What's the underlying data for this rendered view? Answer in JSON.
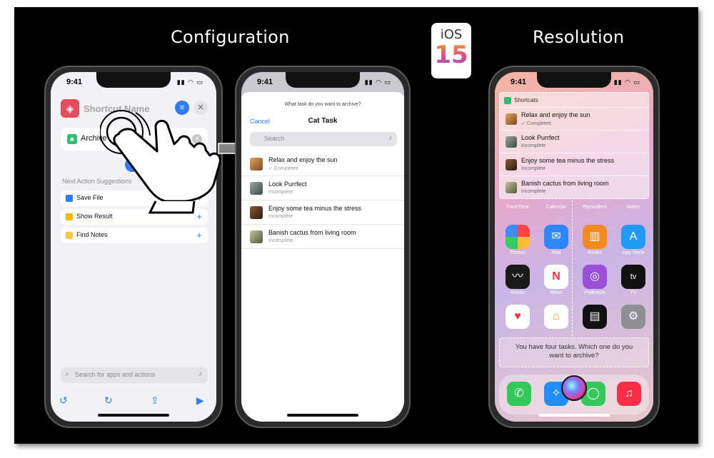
{
  "titles": {
    "configuration": "Configuration",
    "resolution": "Resolution"
  },
  "ios_badge": {
    "line1": "iOS",
    "line2": "15"
  },
  "phone1": {
    "time": "9:41",
    "header_title": "Shortcut Name",
    "action": {
      "label": "Archive",
      "param": "Cat Task"
    },
    "suggestions_heading": "Next Action Suggestions",
    "suggestions": [
      {
        "label": "Save File",
        "color": "#2f7cf6"
      },
      {
        "label": "Show Result",
        "color": "#f5b800"
      },
      {
        "label": "Find Notes",
        "color": "#f5c84a"
      }
    ],
    "search_placeholder": "Search for apps and actions"
  },
  "phone2": {
    "time": "9:41",
    "prompt": "What task do you want to archive?",
    "cancel": "Cancel",
    "title": "Cat Task",
    "search_placeholder": "Search",
    "tasks": [
      {
        "title": "Relax and enjoy the sun",
        "status": "✓ Completed"
      },
      {
        "title": "Look Purrfect",
        "status": "Incomplete"
      },
      {
        "title": "Enjoy some tea minus the stress",
        "status": "Incomplete"
      },
      {
        "title": "Banish cactus from living room",
        "status": "Incomplete"
      }
    ]
  },
  "phone3": {
    "widget_title": "Shortcats",
    "tasks": [
      {
        "title": "Relax and enjoy the sun",
        "status": "✓ Completed"
      },
      {
        "title": "Look Purrfect",
        "status": "Incomplete"
      },
      {
        "title": "Enjoy some tea minus the stress",
        "status": "Incomplete"
      },
      {
        "title": "Banish cactus from living room",
        "status": "Incomplete"
      }
    ],
    "apps": [
      {
        "name": "FaceTime"
      },
      {
        "name": "Calendar"
      },
      {
        "name": "Reminders"
      },
      {
        "name": "Notes"
      },
      {
        "name": "Photos"
      },
      {
        "name": "Mail"
      },
      {
        "name": "Books"
      },
      {
        "name": "App Store"
      },
      {
        "name": "Stocks"
      },
      {
        "name": "News"
      },
      {
        "name": "Podcasts"
      },
      {
        "name": "TV"
      }
    ],
    "siri_response": "You have four tasks. Which one do you want to archive?"
  }
}
